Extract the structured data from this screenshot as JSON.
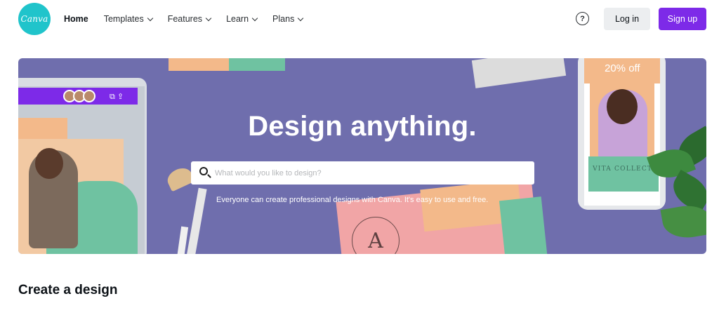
{
  "nav": {
    "logo_text": "Canva",
    "links": [
      {
        "label": "Home",
        "active": true,
        "dropdown": false
      },
      {
        "label": "Templates",
        "active": false,
        "dropdown": true
      },
      {
        "label": "Features",
        "active": false,
        "dropdown": true
      },
      {
        "label": "Learn",
        "active": false,
        "dropdown": true
      },
      {
        "label": "Plans",
        "active": false,
        "dropdown": true
      }
    ],
    "help_icon": "question-circle-icon",
    "help_glyph": "?",
    "login_label": "Log in",
    "signup_label": "Sign up"
  },
  "hero": {
    "title": "Design anything.",
    "search_placeholder": "What would you like to design?",
    "subtitle": "Everyone can create professional designs with Canva. It's easy to use and free.",
    "promo_text": "20% off",
    "card_letter": "A",
    "phone_caption": "VITA COLLECTI"
  },
  "main": {
    "section_title": "Create a design"
  },
  "colors": {
    "brand_teal": "#20c4cb",
    "signup_purple": "#7d2ae8",
    "hero_bg": "#6f6ead"
  }
}
